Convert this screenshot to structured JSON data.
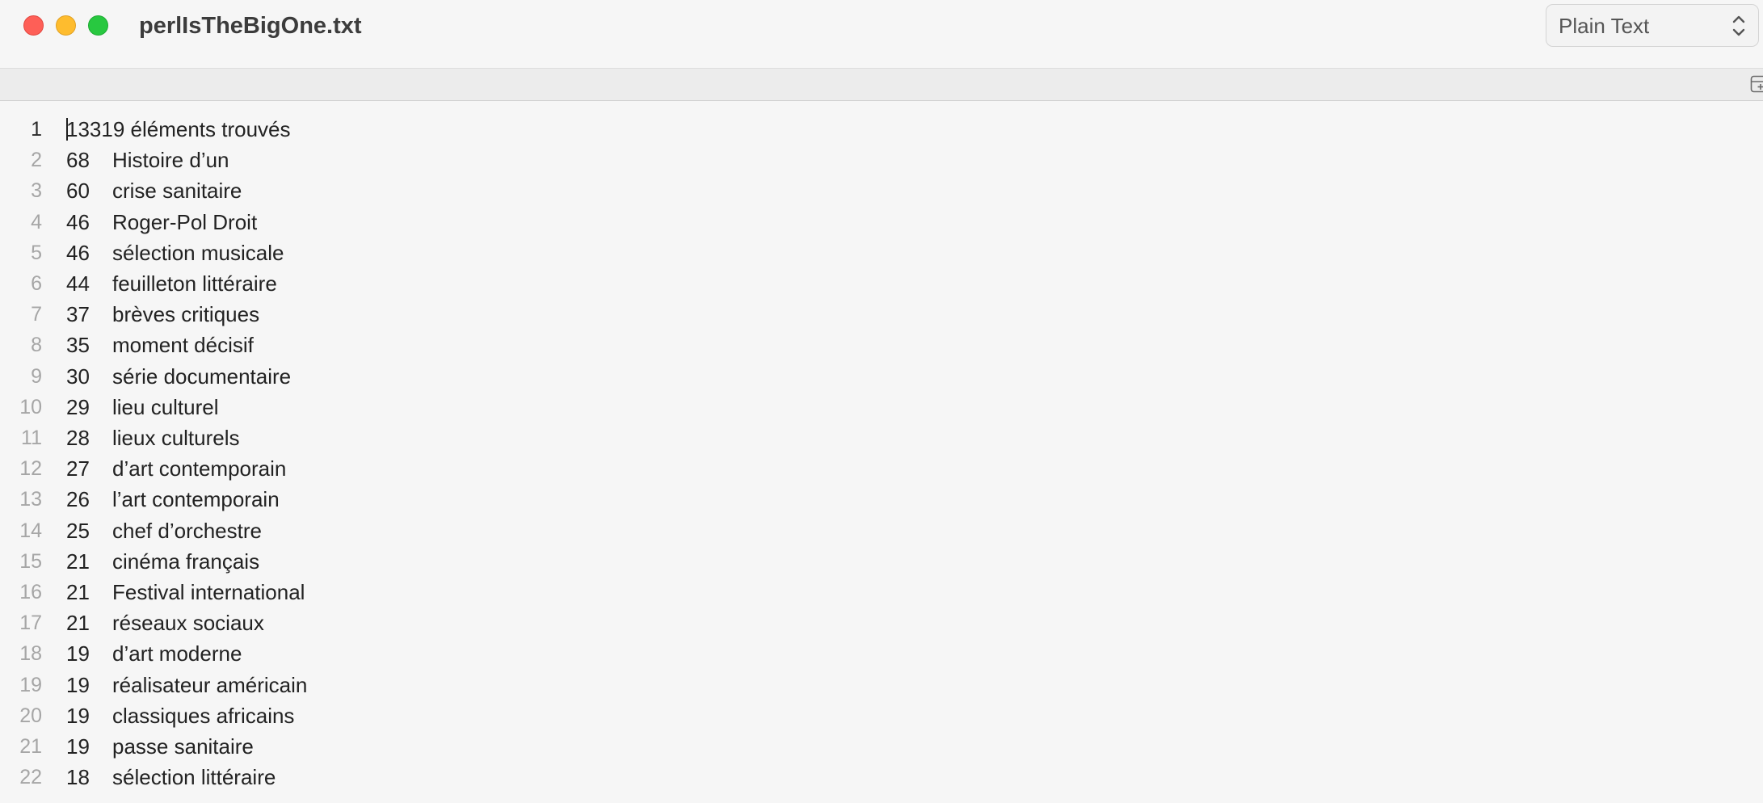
{
  "window": {
    "title": "perlIsTheBigOne.txt",
    "syntax_mode": "Plain Text"
  },
  "icons": {
    "close": "close-button",
    "minimize": "minimize-button",
    "zoom": "zoom-button",
    "syntax_chevron": "chevron-up-down-icon",
    "add_panel": "add-panel-icon"
  },
  "colors": {
    "close": "#fe5f57",
    "minimize": "#febc2e",
    "zoom": "#28c840"
  },
  "editor": {
    "current_line": 1,
    "first_line": {
      "number": "1",
      "text": "13319 éléments trouvés"
    },
    "lines": [
      {
        "number": "2",
        "count": "68",
        "term": "Histoire d’un"
      },
      {
        "number": "3",
        "count": "60",
        "term": "crise sanitaire"
      },
      {
        "number": "4",
        "count": "46",
        "term": "Roger-Pol Droit"
      },
      {
        "number": "5",
        "count": "46",
        "term": "sélection musicale"
      },
      {
        "number": "6",
        "count": "44",
        "term": "feuilleton littéraire"
      },
      {
        "number": "7",
        "count": "37",
        "term": "brèves critiques"
      },
      {
        "number": "8",
        "count": "35",
        "term": "moment décisif"
      },
      {
        "number": "9",
        "count": "30",
        "term": "série documentaire"
      },
      {
        "number": "10",
        "count": "29",
        "term": "lieu culturel"
      },
      {
        "number": "11",
        "count": "28",
        "term": "lieux culturels"
      },
      {
        "number": "12",
        "count": "27",
        "term": "d’art contemporain"
      },
      {
        "number": "13",
        "count": "26",
        "term": "l’art contemporain"
      },
      {
        "number": "14",
        "count": "25",
        "term": "chef d’orchestre"
      },
      {
        "number": "15",
        "count": "21",
        "term": "cinéma français"
      },
      {
        "number": "16",
        "count": "21",
        "term": "Festival international"
      },
      {
        "number": "17",
        "count": "21",
        "term": "réseaux sociaux"
      },
      {
        "number": "18",
        "count": "19",
        "term": "d’art moderne"
      },
      {
        "number": "19",
        "count": "19",
        "term": "réalisateur américain"
      },
      {
        "number": "20",
        "count": "19",
        "term": "classiques africains"
      },
      {
        "number": "21",
        "count": "19",
        "term": "passe sanitaire"
      },
      {
        "number": "22",
        "count": "18",
        "term": "sélection littéraire"
      }
    ]
  }
}
